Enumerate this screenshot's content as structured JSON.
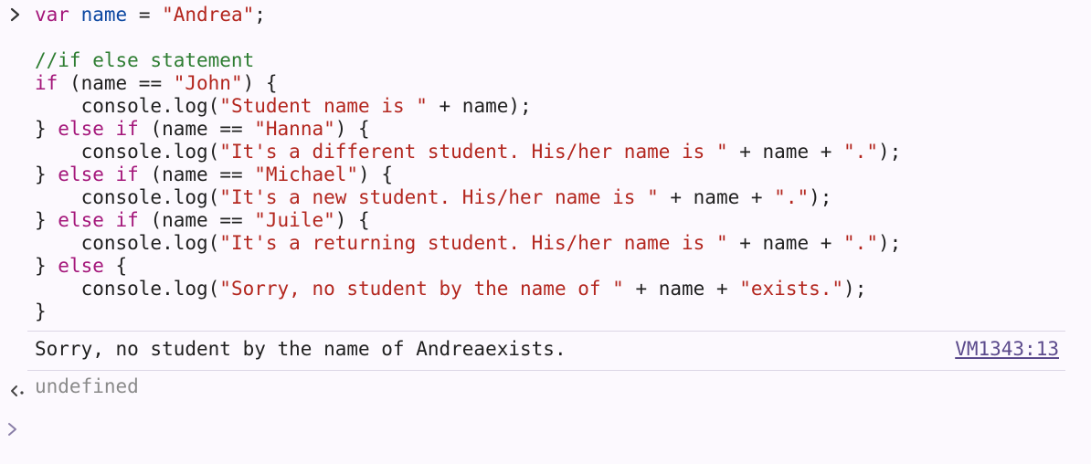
{
  "console": {
    "input_lines": [
      [
        {
          "t": "var",
          "c": "kw"
        },
        {
          "t": " ",
          "c": "plain"
        },
        {
          "t": "name",
          "c": "var"
        },
        {
          "t": " = ",
          "c": "plain"
        },
        {
          "t": "\"Andrea\"",
          "c": "str"
        },
        {
          "t": ";",
          "c": "plain"
        }
      ],
      [],
      [
        {
          "t": "//if else statement",
          "c": "cm"
        }
      ],
      [
        {
          "t": "if",
          "c": "kw"
        },
        {
          "t": " (name == ",
          "c": "plain"
        },
        {
          "t": "\"John\"",
          "c": "str"
        },
        {
          "t": ") {",
          "c": "plain"
        }
      ],
      [
        {
          "t": "    console.log(",
          "c": "plain"
        },
        {
          "t": "\"Student name is \"",
          "c": "str"
        },
        {
          "t": " + name);",
          "c": "plain"
        }
      ],
      [
        {
          "t": "} ",
          "c": "plain"
        },
        {
          "t": "else if",
          "c": "kw"
        },
        {
          "t": " (name == ",
          "c": "plain"
        },
        {
          "t": "\"Hanna\"",
          "c": "str"
        },
        {
          "t": ") {",
          "c": "plain"
        }
      ],
      [
        {
          "t": "    console.log(",
          "c": "plain"
        },
        {
          "t": "\"It's a different student. His/her name is \"",
          "c": "str"
        },
        {
          "t": " + name + ",
          "c": "plain"
        },
        {
          "t": "\".\"",
          "c": "str"
        },
        {
          "t": ");",
          "c": "plain"
        }
      ],
      [
        {
          "t": "} ",
          "c": "plain"
        },
        {
          "t": "else if",
          "c": "kw"
        },
        {
          "t": " (name == ",
          "c": "plain"
        },
        {
          "t": "\"Michael\"",
          "c": "str"
        },
        {
          "t": ") {",
          "c": "plain"
        }
      ],
      [
        {
          "t": "    console.log(",
          "c": "plain"
        },
        {
          "t": "\"It's a new student. His/her name is \"",
          "c": "str"
        },
        {
          "t": " + name + ",
          "c": "plain"
        },
        {
          "t": "\".\"",
          "c": "str"
        },
        {
          "t": ");",
          "c": "plain"
        }
      ],
      [
        {
          "t": "} ",
          "c": "plain"
        },
        {
          "t": "else if",
          "c": "kw"
        },
        {
          "t": " (name == ",
          "c": "plain"
        },
        {
          "t": "\"Juile\"",
          "c": "str"
        },
        {
          "t": ") {",
          "c": "plain"
        }
      ],
      [
        {
          "t": "    console.log(",
          "c": "plain"
        },
        {
          "t": "\"It's a returning student. His/her name is \"",
          "c": "str"
        },
        {
          "t": " + name + ",
          "c": "plain"
        },
        {
          "t": "\".\"",
          "c": "str"
        },
        {
          "t": ");",
          "c": "plain"
        }
      ],
      [
        {
          "t": "} ",
          "c": "plain"
        },
        {
          "t": "else",
          "c": "kw"
        },
        {
          "t": " {",
          "c": "plain"
        }
      ],
      [
        {
          "t": "    console.log(",
          "c": "plain"
        },
        {
          "t": "\"Sorry, no student by the name of \"",
          "c": "str"
        },
        {
          "t": " + name + ",
          "c": "plain"
        },
        {
          "t": "\"exists.\"",
          "c": "str"
        },
        {
          "t": ");",
          "c": "plain"
        }
      ],
      [
        {
          "t": "}",
          "c": "plain"
        }
      ]
    ],
    "log_output": "Sorry, no student by the name of Andreaexists.",
    "log_source": "VM1343:13",
    "return_value": "undefined",
    "icons": {
      "input_prompt": "chevron-right-icon",
      "return_indicator": "return-arrow-icon",
      "new_prompt": "chevron-right-icon"
    },
    "colors": {
      "background": "#fcf9fe",
      "keyword": "#a4167a",
      "string": "#b3261e",
      "variable": "#0b47a1",
      "comment": "#2e7d32",
      "link": "#5b4a8c",
      "muted": "#8a8a8a"
    }
  }
}
